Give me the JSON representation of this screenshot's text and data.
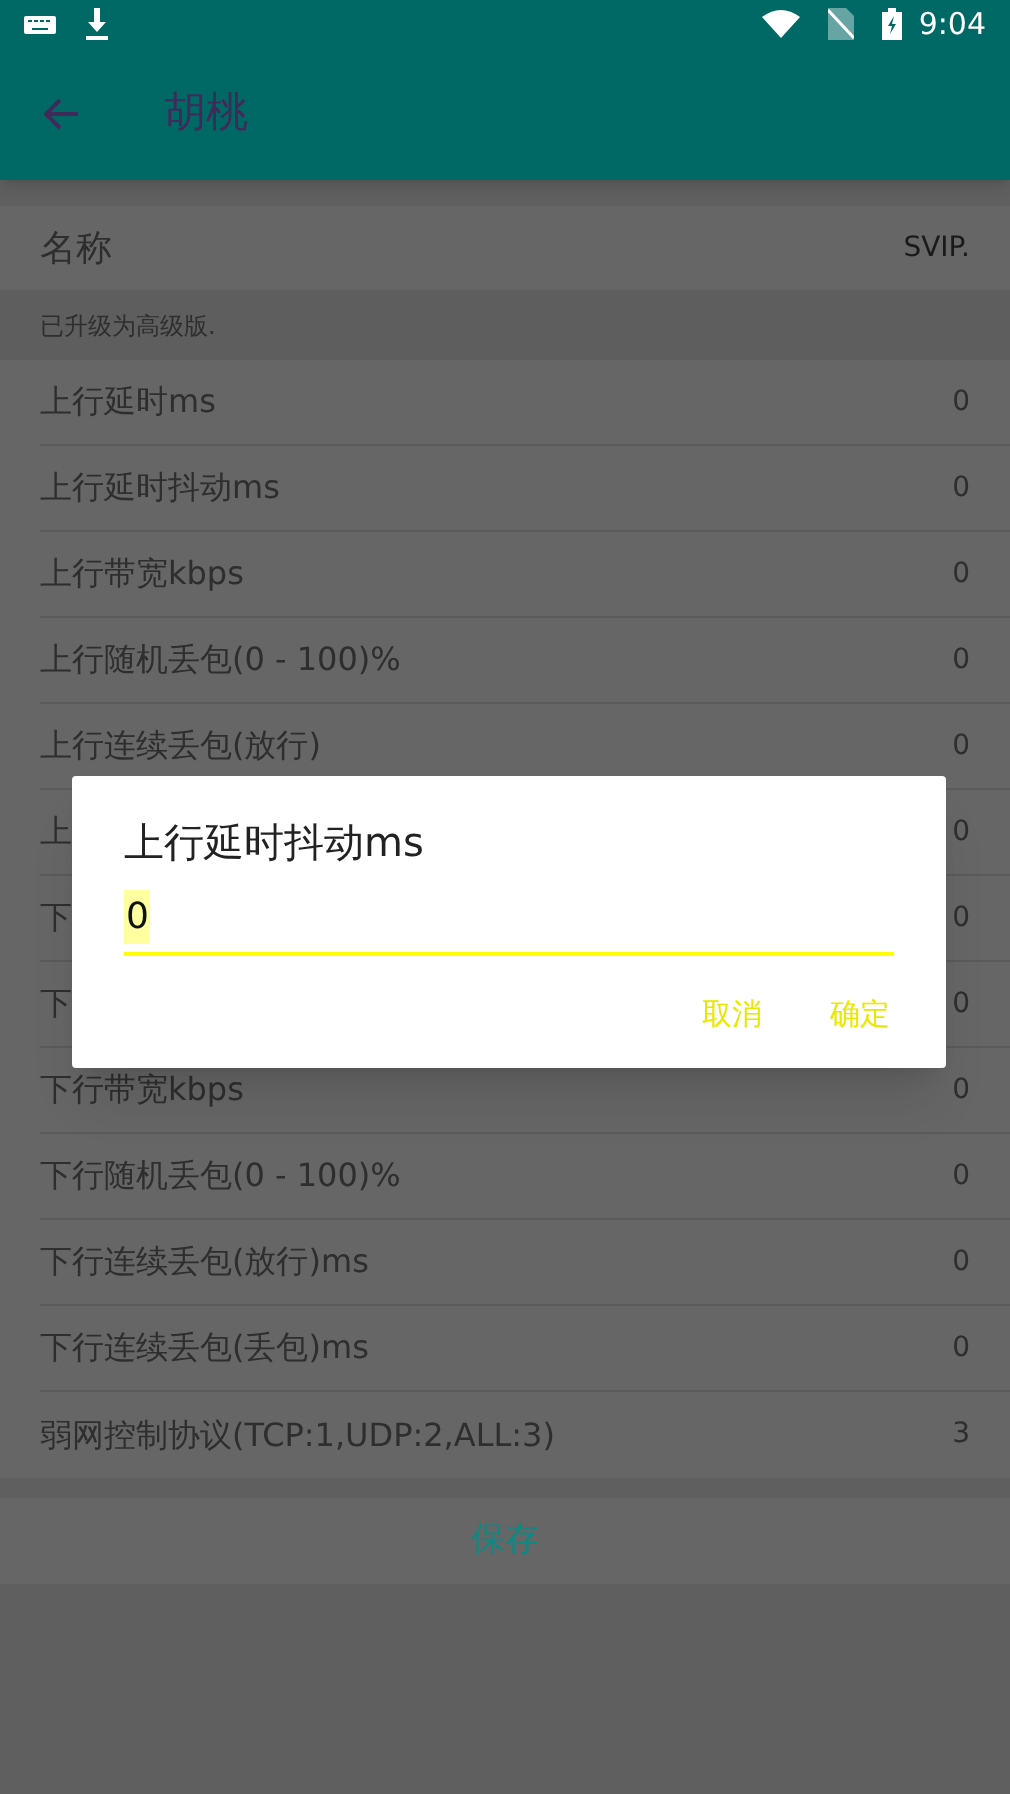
{
  "status_bar": {
    "time": "9:04"
  },
  "app_bar": {
    "title": "胡桃"
  },
  "name_row": {
    "label": "名称",
    "value": "SVIP."
  },
  "notice": "已升级为高级版.",
  "rows": [
    {
      "label": "上行延时ms",
      "value": "0"
    },
    {
      "label": "上行延时抖动ms",
      "value": "0"
    },
    {
      "label": "上行带宽kbps",
      "value": "0"
    },
    {
      "label": "上行随机丢包(0 - 100)%",
      "value": "0"
    },
    {
      "label": "上行连续丢包(放行)",
      "value": "0"
    },
    {
      "label": "上",
      "value": "0"
    },
    {
      "label": "下",
      "value": "0"
    },
    {
      "label": "下",
      "value": "0"
    },
    {
      "label": "下行带宽kbps",
      "value": "0"
    },
    {
      "label": "下行随机丢包(0 - 100)%",
      "value": "0"
    },
    {
      "label": "下行连续丢包(放行)ms",
      "value": "0"
    },
    {
      "label": "下行连续丢包(丢包)ms",
      "value": "0"
    },
    {
      "label": "弱网控制协议(TCP:1,UDP:2,ALL:3)",
      "value": "3"
    }
  ],
  "save_button": "保存",
  "dialog": {
    "title": "上行延时抖动ms",
    "value": "0",
    "buttons": [
      "取消",
      "确定"
    ]
  }
}
